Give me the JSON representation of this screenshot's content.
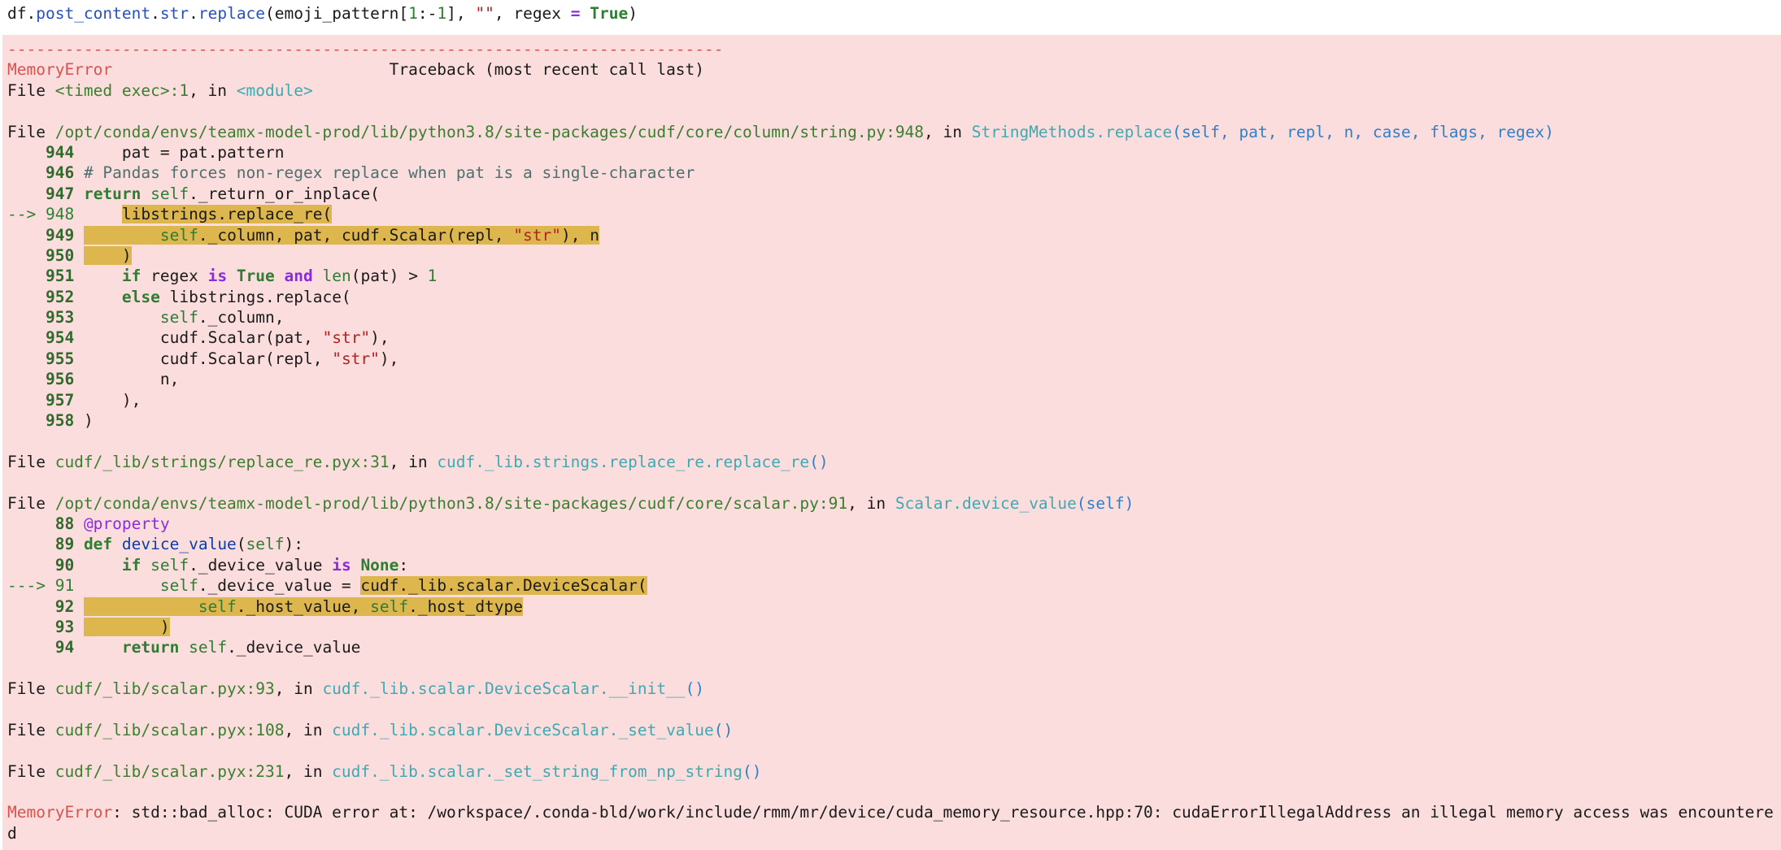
{
  "input_cell": {
    "code_prefix": "df.",
    "attr1": "post_content",
    "dot1": ".",
    "attr2": "str",
    "dot2": ".",
    "method": "replace",
    "args_a": "(emoji_pattern[",
    "num1": "1",
    "colon": ":-",
    "num2": "1",
    "args_b": "], ",
    "empty_str": "\"\"",
    "args_c": ", regex ",
    "eq": "=",
    "sp": " ",
    "true_kw": "True",
    "close": ")"
  },
  "traceback": {
    "dashes": "---------------------------------------------------------------------------",
    "error_name": "MemoryError",
    "header_spacing": "                             ",
    "header_text": "Traceback (most recent call last)",
    "frame0": {
      "file_label": "File ",
      "file": "<timed exec>:1",
      "in_label": ", in ",
      "func": "<module>"
    },
    "frame1": {
      "file_label": "File ",
      "file": "/opt/conda/envs/teamx-model-prod/lib/python3.8/site-packages/cudf/core/column/string.py:948",
      "in_label": ", in ",
      "func": "StringMethods.replace",
      "sig": "(self, pat, repl, n, case, flags, regex)",
      "lines": {
        "l944_num": "944",
        "l944": "pat = pat.pattern",
        "l946_num": "946",
        "l946": "# Pandas forces non-regex replace when pat is a single-character",
        "l947_num": "947",
        "l947_kw": "return",
        "l947_self": "self",
        "l947_rest": "._return_or_inplace(",
        "l948_arrow": "--> 948",
        "l948": "libstrings.replace_re(",
        "l949_num": "949",
        "l949_self": "self",
        "l949_a": "._column, pat, cudf",
        "l949_b": ".Scalar(repl, ",
        "l949_str": "\"str\"",
        "l949_c": "), n",
        "l950_num": "950",
        "l950": ")",
        "l951_num": "951",
        "l951_if": "if",
        "l951_a": " regex ",
        "l951_is": "is",
        "l951_true": "True",
        "l951_and": "and",
        "l951_len": "len",
        "l951_b": "(pat) > ",
        "l951_one": "1",
        "l952_num": "952",
        "l952_else": "else",
        "l952_rest": " libstrings.replace(",
        "l953_num": "953",
        "l953_self": "self",
        "l953_rest": "._column,",
        "l954_num": "954",
        "l954_a": "cudf.Scalar(pat, ",
        "l954_str": "\"str\"",
        "l954_b": "),",
        "l955_num": "955",
        "l955_a": "cudf.Scalar(repl, ",
        "l955_str": "\"str\"",
        "l955_b": "),",
        "l956_num": "956",
        "l956": "n,",
        "l957_num": "957",
        "l957": "),",
        "l958_num": "958",
        "l958": ")"
      }
    },
    "frame2": {
      "file_label": "File ",
      "file": "cudf/_lib/strings/replace_re.pyx:31",
      "in_label": ", in ",
      "func": "cudf._lib.strings.replace_re.replace_re",
      "sig": "()"
    },
    "frame3": {
      "file_label": "File ",
      "file": "/opt/conda/envs/teamx-model-prod/lib/python3.8/site-packages/cudf/core/scalar.py:91",
      "in_label": ", in ",
      "func": "Scalar.device_value",
      "sig": "(self)",
      "lines": {
        "l88_num": "88",
        "l88": "@property",
        "l89_num": "89",
        "l89_def": "def",
        "l89_fn": "device_value",
        "l89_a": "(",
        "l89_self": "self",
        "l89_b": "):",
        "l90_num": "90",
        "l90_if": "if",
        "l90_self": "self",
        "l90_a": "._device_value ",
        "l90_is": "is",
        "l90_none": "None",
        "l90_b": ":",
        "l91_arrow": "---> 91",
        "l91_self": "self",
        "l91_a": "._device_value = ",
        "l91_hl": "cudf._lib.scalar.DeviceScalar(",
        "l92_num": "92",
        "l92_self1": "self",
        "l92_a": "._host_value, ",
        "l92_self2": "self",
        "l92_b": "._host_dtype",
        "l93_num": "93",
        "l93": ")",
        "l94_num": "94",
        "l94_kw": "return",
        "l94_self": "self",
        "l94_rest": "._device_value"
      }
    },
    "frame4": {
      "file_label": "File ",
      "file": "cudf/_lib/scalar.pyx:93",
      "in_label": ", in ",
      "func": "cudf._lib.scalar.DeviceScalar.__init__",
      "sig": "()"
    },
    "frame5": {
      "file_label": "File ",
      "file": "cudf/_lib/scalar.pyx:108",
      "in_label": ", in ",
      "func": "cudf._lib.scalar.DeviceScalar._set_value",
      "sig": "()"
    },
    "frame6": {
      "file_label": "File ",
      "file": "cudf/_lib/scalar.pyx:231",
      "in_label": ", in ",
      "func": "cudf._lib.scalar._set_string_from_np_string",
      "sig": "()"
    },
    "final_error": {
      "name": "MemoryError",
      "message": ": std::bad_alloc: CUDA error at: /workspace/.conda-bld/work/include/rmm/mr/device/cuda_memory_resource.hpp:70: cudaErrorIllegalAddress an illegal memory access was encountere",
      "wrap": "d"
    }
  }
}
